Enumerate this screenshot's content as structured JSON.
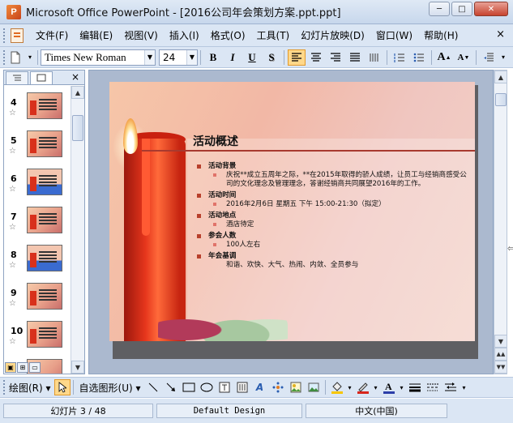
{
  "window": {
    "app_icon_letter": "P",
    "title": "Microsoft Office PowerPoint - [2016公司年会策划方案.ppt.ppt]",
    "minimize": "─",
    "restore": "□",
    "close": "✕"
  },
  "menu": {
    "items": [
      "文件(F)",
      "编辑(E)",
      "视图(V)",
      "插入(I)",
      "格式(O)",
      "工具(T)",
      "幻灯片放映(D)",
      "窗口(W)",
      "帮助(H)"
    ],
    "close": "×"
  },
  "format": {
    "font_name": "Times New Roman",
    "font_size": "24",
    "bold": "B",
    "italic": "I",
    "underline": "U",
    "shadow": "S",
    "grow": "A",
    "shrink": "A"
  },
  "pane": {
    "close": "×",
    "thumbnails": [
      {
        "num": "4"
      },
      {
        "num": "5"
      },
      {
        "num": "6"
      },
      {
        "num": "7"
      },
      {
        "num": "8"
      },
      {
        "num": "9"
      },
      {
        "num": "10"
      }
    ]
  },
  "slide": {
    "title": "活动概述",
    "sections": [
      {
        "heading": "活动背景",
        "items": [
          "庆祝**成立五周年之际，**在2015年取得的骄人成绩，让员工与经销商感受公司的文化理念及管理理念，答谢经销商共同展望2016年的工作。"
        ]
      },
      {
        "heading": "活动时间",
        "items": [
          "2016年2月6日 星期五 下午 15:00-21:30（拟定）"
        ]
      },
      {
        "heading": "活动地点",
        "items": [
          "酒店待定"
        ]
      },
      {
        "heading": "参会人数",
        "items": [
          "100人左右"
        ]
      },
      {
        "heading": "年会基调",
        "items": [
          "和谐、欢快、大气、热闹、内敛、全员参与"
        ]
      }
    ]
  },
  "draw": {
    "label": "绘图(R)",
    "autoshapes": "自选图形(U)"
  },
  "status": {
    "slide": "幻灯片 3 / 48",
    "design": "Default Design",
    "language": "中文(中国)"
  }
}
